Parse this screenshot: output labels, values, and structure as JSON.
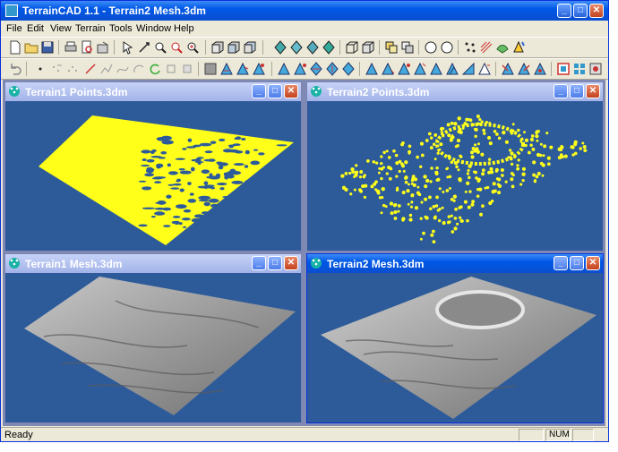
{
  "app": {
    "title": "TerrainCAD 1.1 - Terrain2 Mesh.3dm"
  },
  "menu": [
    "File",
    "Edit",
    "View",
    "Terrain",
    "Tools",
    "Window",
    "Help"
  ],
  "windows": [
    {
      "title": "Terrain1 Points.3dm",
      "content": "point-cloud",
      "active": false
    },
    {
      "title": "Terrain2 Points.3dm",
      "content": "point-cloud",
      "active": false
    },
    {
      "title": "Terrain1 Mesh.3dm",
      "content": "mesh",
      "active": false
    },
    {
      "title": "Terrain2 Mesh.3dm",
      "content": "mesh",
      "active": true
    }
  ],
  "status": {
    "text": "Ready",
    "indicator": "NUM"
  },
  "colors": {
    "viewport_background": "#2d5b9a",
    "points": "#ffff1a",
    "mesh": "#9a9a9a",
    "titlebar_active": "#0058e6",
    "titlebar_inactive": "#a3b3e8"
  }
}
